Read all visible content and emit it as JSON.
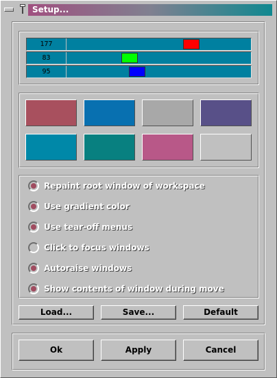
{
  "window": {
    "title": "Setup..."
  },
  "titlebar": {
    "minimize_icon": "minimize-icon",
    "pin_icon": "pushpin-icon"
  },
  "sliders": [
    {
      "value": "177",
      "knob_color": "#ff0000",
      "level_fraction": 0.694
    },
    {
      "value": "83",
      "knob_color": "#00ff00",
      "level_fraction": 0.325
    },
    {
      "value": "95",
      "knob_color": "#0000ff",
      "level_fraction": 0.373
    }
  ],
  "swatches": [
    "#a8505e",
    "#0870b0",
    "#a8a8a8",
    "#585088",
    "#0088a8",
    "#088080",
    "#b85888",
    "#c0c0c0"
  ],
  "options": [
    {
      "label": "Repaint root window of workspace",
      "checked": true
    },
    {
      "label": "Use gradient color",
      "checked": true
    },
    {
      "label": "Use tear-off menus",
      "checked": true
    },
    {
      "label": "Click to focus windows",
      "checked": false
    },
    {
      "label": "Autoraise windows",
      "checked": true
    },
    {
      "label": "Show contents of window during move",
      "checked": true
    }
  ],
  "file_buttons": {
    "load": "Load...",
    "save": "Save...",
    "default": "Default"
  },
  "dialog_buttons": {
    "ok": "Ok",
    "apply": "Apply",
    "cancel": "Cancel"
  },
  "colors": {
    "background": "#c0c0c0",
    "slider_track": "#0080a0",
    "radio_selected": "#a04c60",
    "title_gradient_start": "#a05080",
    "title_gradient_end": "#108890"
  }
}
